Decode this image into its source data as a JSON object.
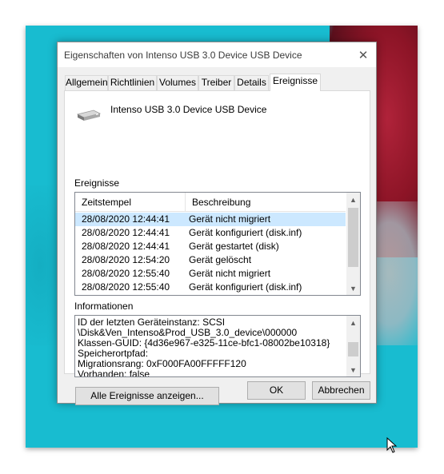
{
  "window": {
    "title": "Eigenschaften von Intenso USB 3.0 Device USB Device",
    "close_glyph": "✕"
  },
  "tabs": [
    {
      "label": "Allgemein",
      "active": false
    },
    {
      "label": "Richtlinien",
      "active": false
    },
    {
      "label": "Volumes",
      "active": false
    },
    {
      "label": "Treiber",
      "active": false
    },
    {
      "label": "Details",
      "active": false
    },
    {
      "label": "Ereignisse",
      "active": true
    }
  ],
  "device": {
    "icon": "usb-drive-icon",
    "name": "Intenso USB 3.0 Device USB Device"
  },
  "events": {
    "section_label": "Ereignisse",
    "columns": [
      "Zeitstempel",
      "Beschreibung"
    ],
    "rows": [
      {
        "timestamp": "28/08/2020 12:44:41",
        "description": "Gerät nicht migriert",
        "selected": true
      },
      {
        "timestamp": "28/08/2020 12:44:41",
        "description": "Gerät konfiguriert (disk.inf)",
        "selected": false
      },
      {
        "timestamp": "28/08/2020 12:44:41",
        "description": "Gerät gestartet (disk)",
        "selected": false
      },
      {
        "timestamp": "28/08/2020 12:54:20",
        "description": "Gerät gelöscht",
        "selected": false
      },
      {
        "timestamp": "28/08/2020 12:55:40",
        "description": "Gerät nicht migriert",
        "selected": false
      },
      {
        "timestamp": "28/08/2020 12:55:40",
        "description": "Gerät konfiguriert (disk.inf)",
        "selected": false
      }
    ]
  },
  "information": {
    "section_label": "Informationen",
    "lines": [
      "ID der letzten Geräteinstanz: SCSI",
      "\\Disk&Ven_Intenso&Prod_USB_3.0_device\\000000",
      "Klassen-GUID: {4d36e967-e325-11ce-bfc1-08002be10318}",
      "Speicherortpfad:",
      "Migrationsrang: 0xF000FA00FFFFF120",
      "Vorhanden: false"
    ]
  },
  "buttons": {
    "show_all": "Alle Ereignisse anzeigen...",
    "ok": "OK",
    "cancel": "Abbrechen"
  },
  "scrollbar": {
    "up_glyph": "▲",
    "down_glyph": "▼"
  },
  "colors": {
    "desktop": "#18bcd0",
    "selection": "#cce8ff"
  }
}
